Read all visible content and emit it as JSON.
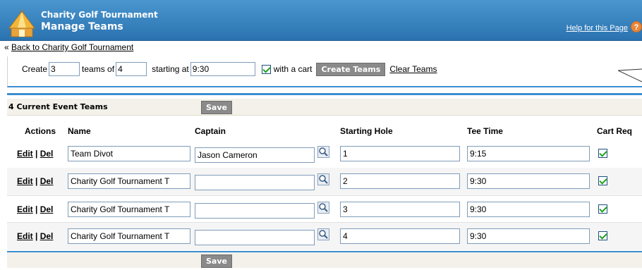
{
  "header": {
    "title_line1": "Charity Golf Tournament",
    "title_line2": "Manage Teams",
    "help_link": "Help for this Page",
    "help_icon_text": "?"
  },
  "back_prefix": "«",
  "back_link": "Back to Charity Golf Tournament",
  "create": {
    "label_create": "Create",
    "teams_value": "3",
    "label_teams_of": "teams of",
    "size_value": "4",
    "label_starting_at": "starting at",
    "start_value": "9:30",
    "cart_checked": true,
    "label_with_cart": "with a cart",
    "create_button": "Create Teams",
    "clear_link": "Clear Teams"
  },
  "teams": {
    "title": "4 Current Event Teams",
    "save_label": "Save",
    "columns": {
      "actions": "Actions",
      "name": "Name",
      "captain": "Captain",
      "starting_hole": "Starting Hole",
      "tee_time": "Tee Time",
      "cart_req": "Cart Req"
    },
    "edit_label": "Edit",
    "separator": "|",
    "del_label": "Del",
    "rows": [
      {
        "name": "Team Divot",
        "captain": "Jason Cameron",
        "hole": "1",
        "tee": "9:15",
        "cart": true
      },
      {
        "name": "Charity Golf Tournament T",
        "captain": "",
        "hole": "2",
        "tee": "9:30",
        "cart": true
      },
      {
        "name": "Charity Golf Tournament T",
        "captain": "",
        "hole": "3",
        "tee": "9:30",
        "cart": true
      },
      {
        "name": "Charity Golf Tournament T",
        "captain": "",
        "hole": "4",
        "tee": "9:30",
        "cart": true
      }
    ]
  },
  "colors": {
    "header_blue": "#2a73b0",
    "accent_blue": "#3b8ed0",
    "button_gray": "#8a8a8a",
    "panel_beige": "#f3f1e9",
    "check_green": "#21a121"
  }
}
